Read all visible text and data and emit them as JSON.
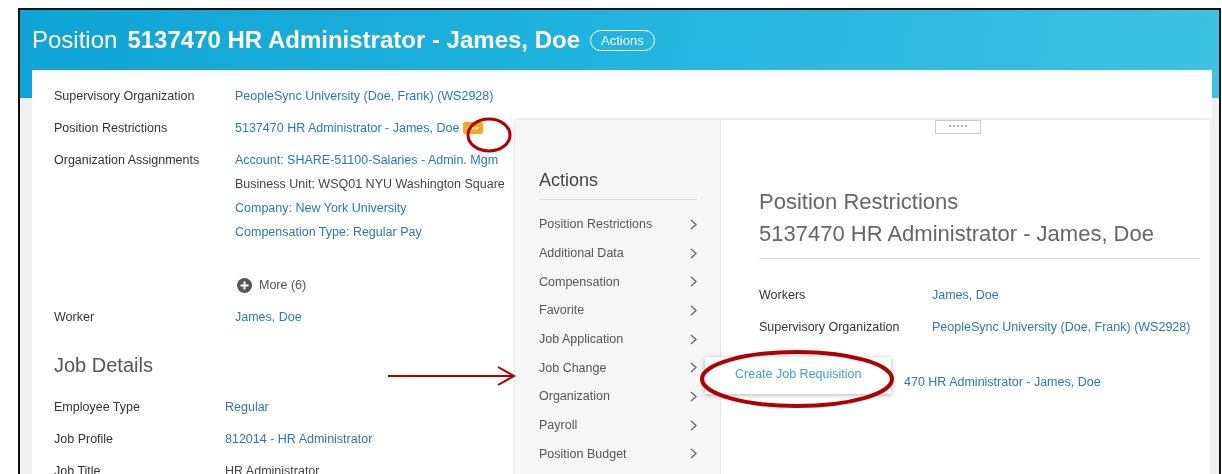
{
  "header": {
    "title_prefix": "Position",
    "title": "5137470 HR Administrator - James, Doe",
    "actions_button": "Actions"
  },
  "fields": [
    {
      "label": "Supervisory Organization",
      "values": [
        {
          "text": "PeopleSync University (Doe, Frank) (WS2928)",
          "link": true
        }
      ]
    },
    {
      "label": "Position Restrictions",
      "values": [
        {
          "text": "5137470 HR Administrator - James, Doe",
          "link": true,
          "related_actions": true
        }
      ]
    },
    {
      "label": "Organization Assignments",
      "values": [
        {
          "text": "Account: SHARE-51100-Salaries - Admin. Mgm",
          "link": true
        },
        {
          "text": "Business Unit: WSQ01 NYU Washington Square",
          "link": false
        },
        {
          "text": "Company: New York University",
          "link": true
        },
        {
          "text": "Compensation Type: Regular Pay",
          "link": true
        }
      ],
      "more": "More (6)"
    },
    {
      "label": "Worker",
      "values": [
        {
          "text": "James, Doe",
          "link": true
        }
      ]
    }
  ],
  "section": {
    "title": "Job Details",
    "fields": [
      {
        "label": "Employee Type",
        "values": [
          {
            "text": "Regular",
            "link": true
          }
        ]
      },
      {
        "label": "Job Profile",
        "values": [
          {
            "text": "812014 - HR Administrator",
            "link": true
          }
        ]
      },
      {
        "label": "Job Title",
        "values": [
          {
            "text": "HR Administrator",
            "link": false
          }
        ]
      }
    ]
  },
  "action_menu": {
    "title": "Actions",
    "items": [
      {
        "label": "Position Restrictions"
      },
      {
        "label": "Additional Data"
      },
      {
        "label": "Compensation"
      },
      {
        "label": "Favorite"
      },
      {
        "label": "Job Application"
      },
      {
        "label": "Job Change"
      },
      {
        "label": "Organization"
      },
      {
        "label": "Payroll"
      },
      {
        "label": "Position Budget"
      }
    ]
  },
  "related_panel": {
    "title": "Position Restrictions",
    "subtitle": "5137470 HR Administrator - James, Doe",
    "fields": [
      {
        "label": "Workers",
        "value": "James, Doe"
      },
      {
        "label": "Supervisory Organization",
        "value": "PeopleSync University (Doe, Frank) (WS2928)"
      }
    ],
    "partial_value": "470 HR Administrator - James, Doe"
  },
  "submenu": {
    "items": [
      "Create Job Requisition"
    ]
  }
}
